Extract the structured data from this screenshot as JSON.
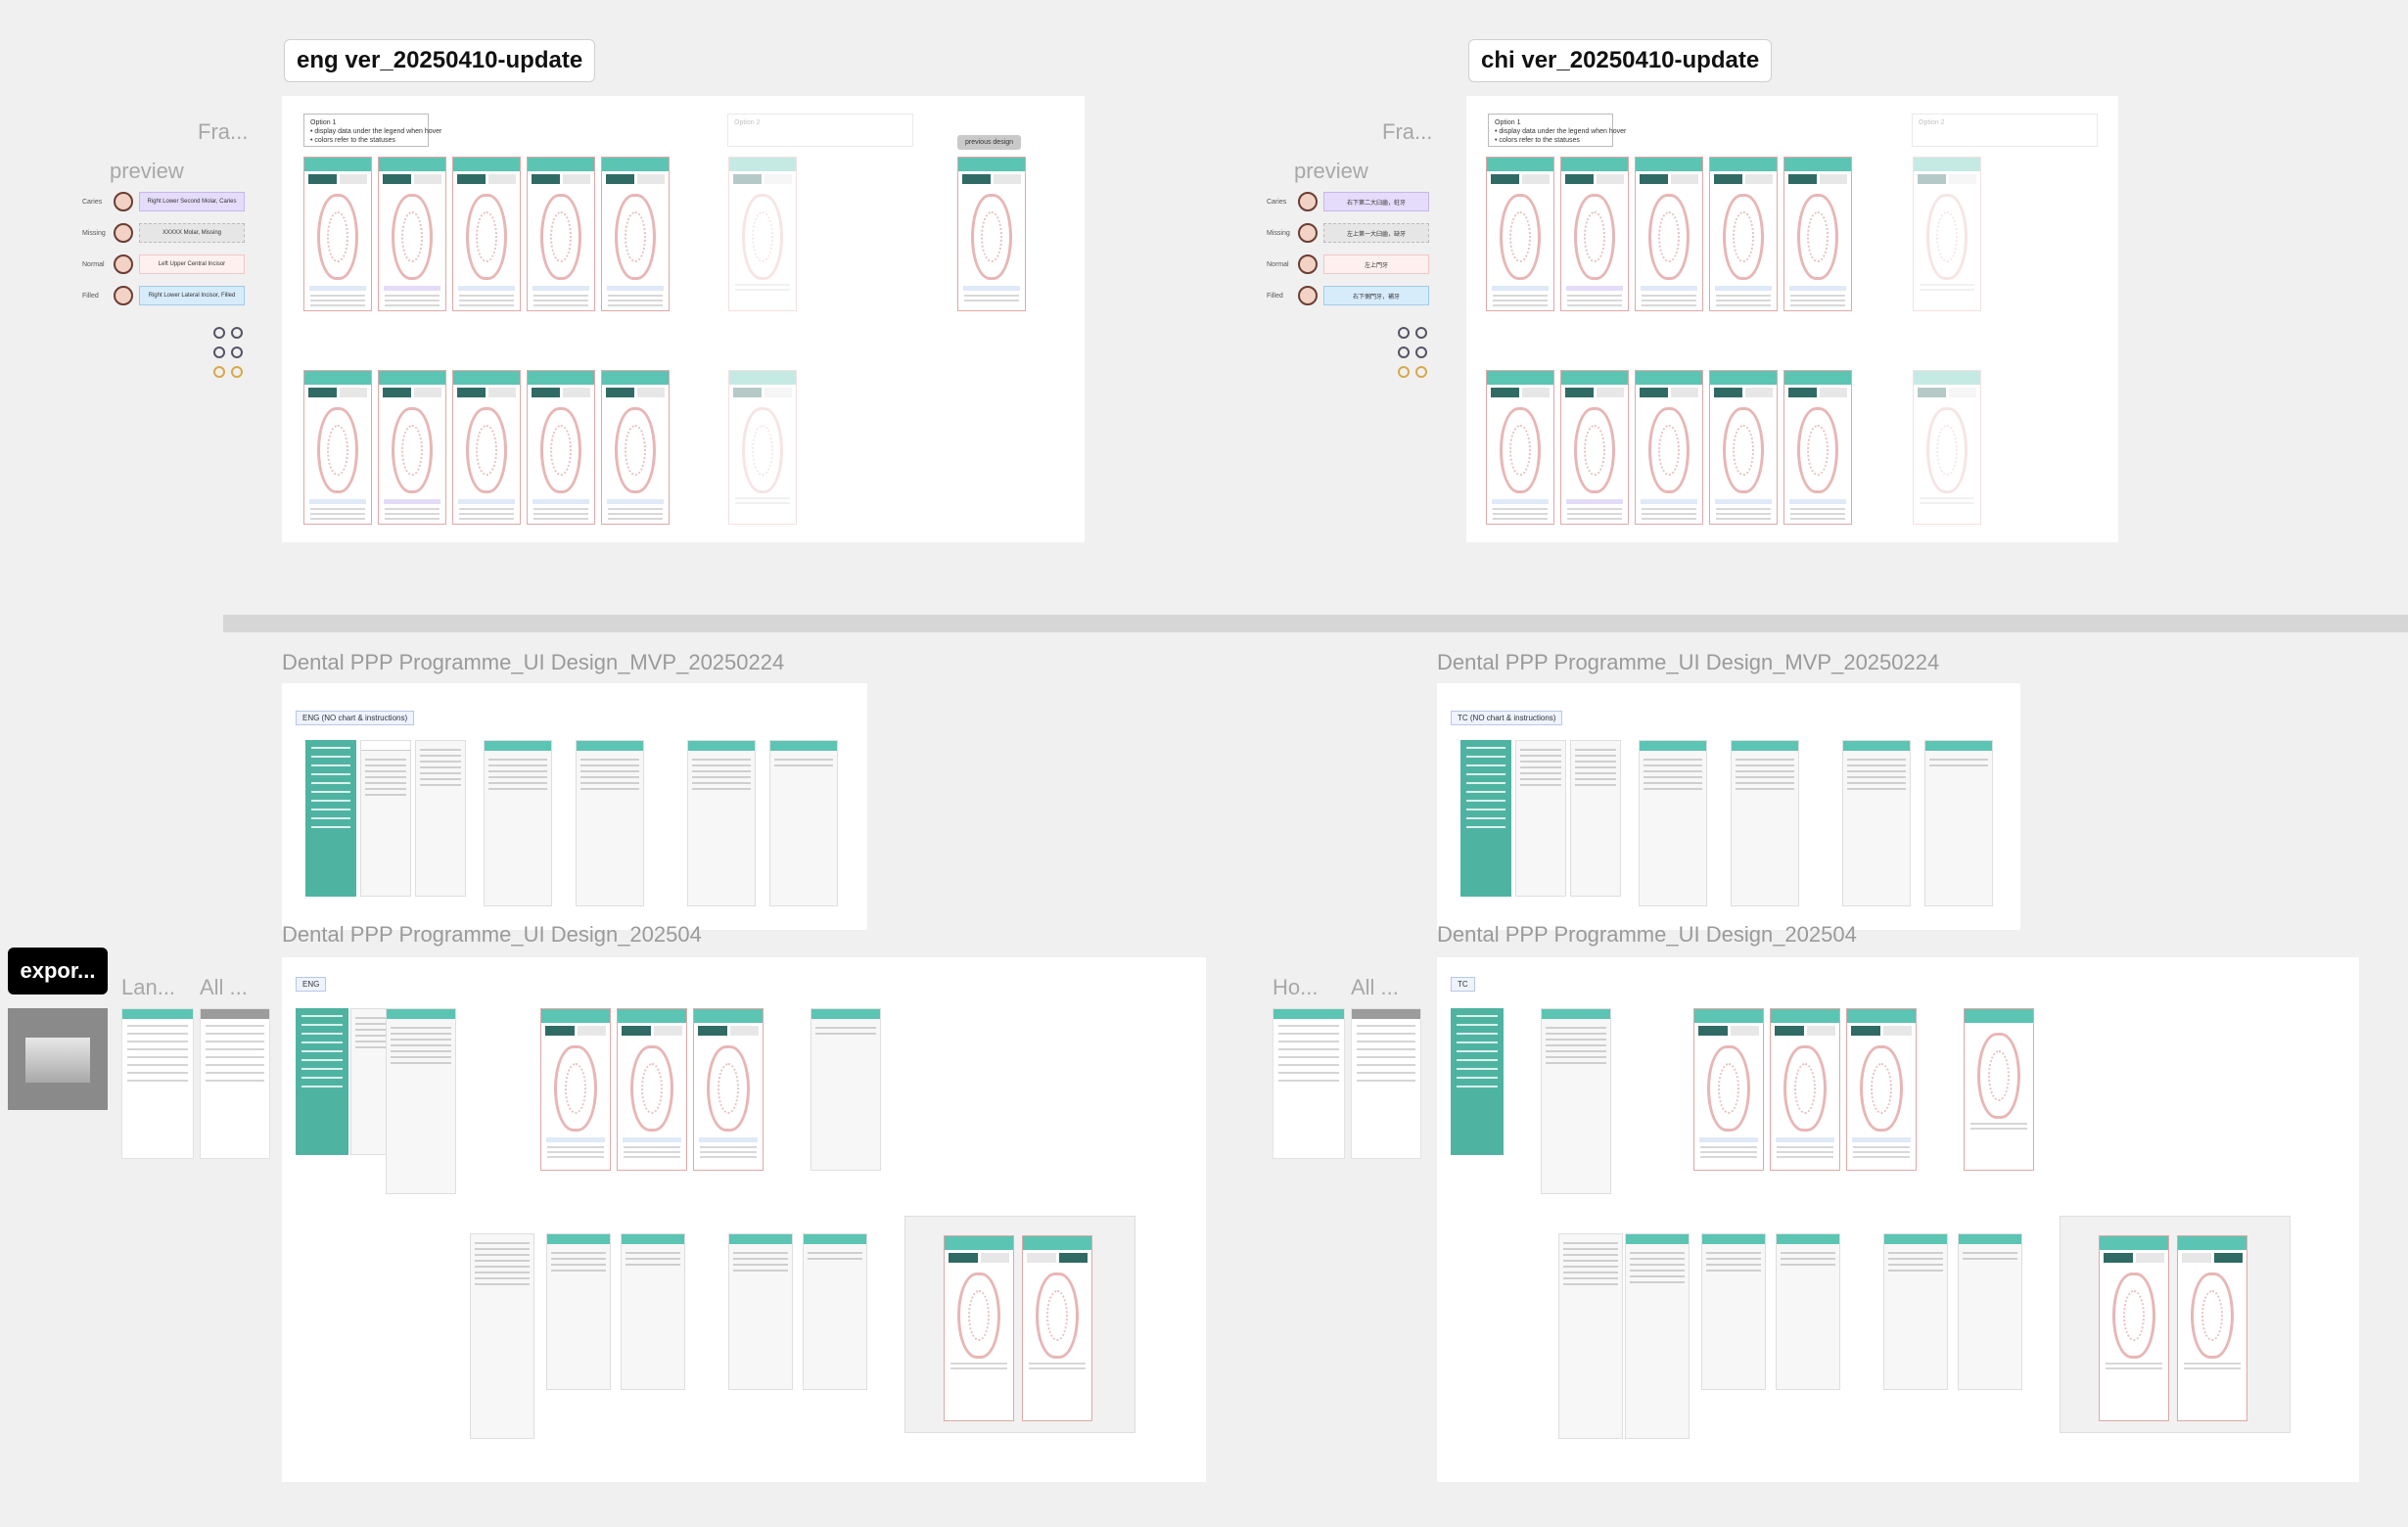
{
  "canvas": {
    "background": "#f0f0f0",
    "accent": "#5cc4b3",
    "dark_teal": "#2f6b64"
  },
  "frames": {
    "eng_update": {
      "label": "eng ver_20250410-update",
      "ghost_label": "Fra...",
      "preview_label": "preview",
      "option1": "Option 1\n• display data under the legend when hover\n• colors refer to the statuses",
      "option2": "Option 2",
      "previous_design": "previous design",
      "legend": [
        {
          "status": "Caries",
          "text": "Right Lower Second Molar, Caries"
        },
        {
          "status": "Missing",
          "text": "XXXXX Molar, Missing"
        },
        {
          "status": "Normal",
          "text": "Left Upper Central Incisor"
        },
        {
          "status": "Filled",
          "text": "Right Lower Lateral Incisor, Filled"
        }
      ]
    },
    "chi_update": {
      "label": "chi ver_20250410-update",
      "ghost_label": "Fra...",
      "preview_label": "preview",
      "option1": "Option 1\n• display data under the legend when hover\n• colors refer to the statuses",
      "option2": "Option 2",
      "legend": [
        {
          "status": "Caries",
          "text": "右下第二大臼齒，蛀牙"
        },
        {
          "status": "Missing",
          "text": "左上第一大臼齒，缺牙"
        },
        {
          "status": "Normal",
          "text": "左上門牙"
        },
        {
          "status": "Filled",
          "text": "右下側門牙，補牙"
        }
      ]
    },
    "mvp_eng": {
      "title": "Dental PPP Programme_UI Design_MVP_20250224",
      "tag": "ENG (NO chart & instructions)"
    },
    "mvp_tc": {
      "title": "Dental PPP Programme_UI Design_MVP_20250224",
      "tag": "TC (NO chart & instructions)"
    },
    "d202504_eng": {
      "title": "Dental PPP Programme_UI Design_202504",
      "tag": "ENG"
    },
    "d202504_tc": {
      "title": "Dental PPP Programme_UI Design_202504",
      "tag": "TC"
    }
  },
  "sidebar_labels": {
    "export": "expor...",
    "lan": "Lan...",
    "all_left": "All ...",
    "ho": "Ho...",
    "all_right": "All ..."
  }
}
